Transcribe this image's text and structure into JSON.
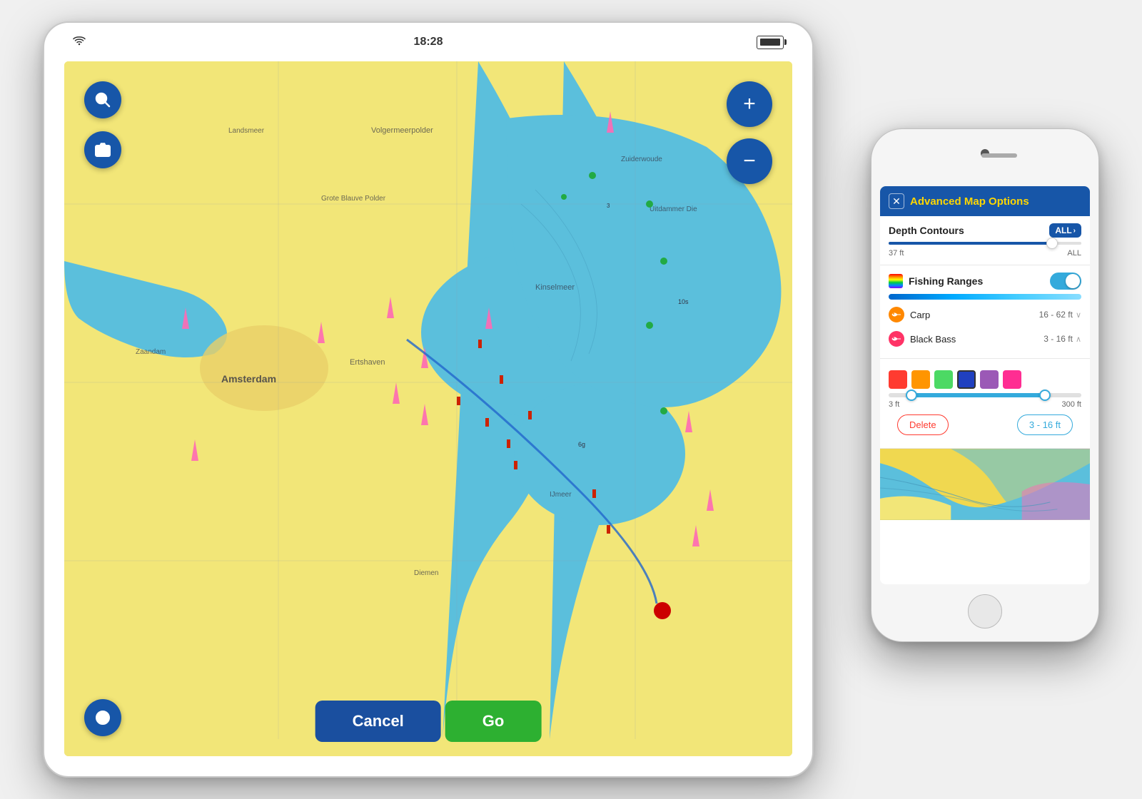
{
  "tablet": {
    "status_bar": {
      "wifi": "WiFi",
      "time": "18:28",
      "battery": "▓▓▓"
    },
    "buttons": {
      "search": "🔍",
      "camera": "📷",
      "compass": "🧭",
      "zoom_in": "+",
      "zoom_out": "−",
      "cancel": "Cancel",
      "go": "Go"
    }
  },
  "phone": {
    "header": {
      "close": "✕",
      "title": "Advanced Map Options"
    },
    "depth_contours": {
      "label": "Depth Contours",
      "badge": "ALL",
      "slider_min": "37 ft",
      "slider_max": "ALL"
    },
    "fishing_ranges": {
      "label": "Fishing Ranges",
      "toggle_on": true
    },
    "fish_items": [
      {
        "name": "Carp",
        "range": "16 - 62 ft",
        "color": "#ff8800",
        "icon_color": "#ff8800"
      },
      {
        "name": "Black Bass",
        "range": "3 - 16 ft",
        "color": "#ff3366",
        "icon_color": "#ff3366"
      }
    ],
    "color_swatches": [
      "#ff3b30",
      "#ff9500",
      "#4cd964",
      "#2040c0",
      "#9b59b6",
      "#ff2d92"
    ],
    "range_slider": {
      "min_label": "3 ft",
      "max_label": "300 ft"
    },
    "actions": {
      "delete": "Delete",
      "range": "3 - 16 ft"
    }
  }
}
